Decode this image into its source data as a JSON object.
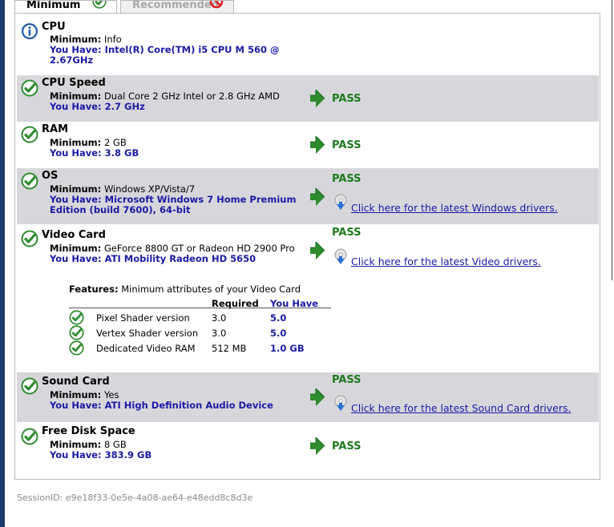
{
  "tabs": {
    "minimum": "Minimum",
    "recommended": "Recommended"
  },
  "rows": [
    {
      "title": "CPU",
      "min_label": "Minimum:",
      "min_value": "Info",
      "you_label": "You Have:",
      "you_value": "Intel(R) Core(TM) i5 CPU M 560 @",
      "you_value_2": "2.67GHz",
      "status_icon": "info-icon"
    },
    {
      "title": "CPU Speed",
      "min_label": "Minimum:",
      "min_value": "Dual Core 2 GHz Intel or 2.8 GHz AMD",
      "you_label": "You Have:",
      "you_value": "2.7 GHz",
      "result": "PASS",
      "status_icon": "check-icon"
    },
    {
      "title": "RAM",
      "min_label": "Minimum:",
      "min_value": "2 GB",
      "you_label": "You Have:",
      "you_value": "3.8 GB",
      "result": "PASS",
      "status_icon": "check-icon"
    },
    {
      "title": "OS",
      "min_label": "Minimum:",
      "min_value": "Windows XP/Vista/7",
      "you_label": "You Have:",
      "you_value": "Microsoft Windows 7 Home Premium",
      "you_value_2": "Edition (build 7600), 64-bit",
      "result": "PASS",
      "driver_link": "Click here for the latest Windows drivers.",
      "status_icon": "check-icon"
    },
    {
      "title": "Video Card",
      "min_label": "Minimum:",
      "min_value": "GeForce 8800 GT or Radeon HD 2900 Pro",
      "you_label": "You Have:",
      "you_value": "ATI Mobility Radeon HD 5650",
      "result": "PASS",
      "driver_link": "Click here for the latest Video drivers.",
      "status_icon": "check-icon"
    },
    {
      "title": "Sound Card",
      "min_label": "Minimum:",
      "min_value": "Yes",
      "you_label": "You Have:",
      "you_value": "ATI High Definition Audio Device",
      "result": "PASS",
      "driver_link": "Click here for the latest Sound Card drivers.",
      "status_icon": "check-icon"
    },
    {
      "title": "Free Disk Space",
      "min_label": "Minimum:",
      "min_value": "8 GB",
      "you_label": "You Have:",
      "you_value": "383.9 GB",
      "result": "PASS",
      "status_icon": "check-icon"
    }
  ],
  "features": {
    "label": "Features:",
    "description": "Minimum attributes of your Video Card",
    "col_required": "Required",
    "col_you_have": "You Have",
    "items": [
      {
        "name": "Pixel Shader version",
        "required": "3.0",
        "you_have": "5.0"
      },
      {
        "name": "Vertex Shader version",
        "required": "3.0",
        "you_have": "5.0"
      },
      {
        "name": "Dedicated Video RAM",
        "required": "512 MB",
        "you_have": "1.0 GB"
      }
    ]
  },
  "session": "SessionID: e9e18f33-0e5e-4a08-ae64-e48edd8c8d3e",
  "colors": {
    "pass": "#1f7a1f",
    "you_have": "#1a1aa6",
    "shaded_row": "#d7d7db",
    "check": "#2e8b2e",
    "info": "#1e5aa8",
    "left_bar": "#1c3a6c"
  }
}
